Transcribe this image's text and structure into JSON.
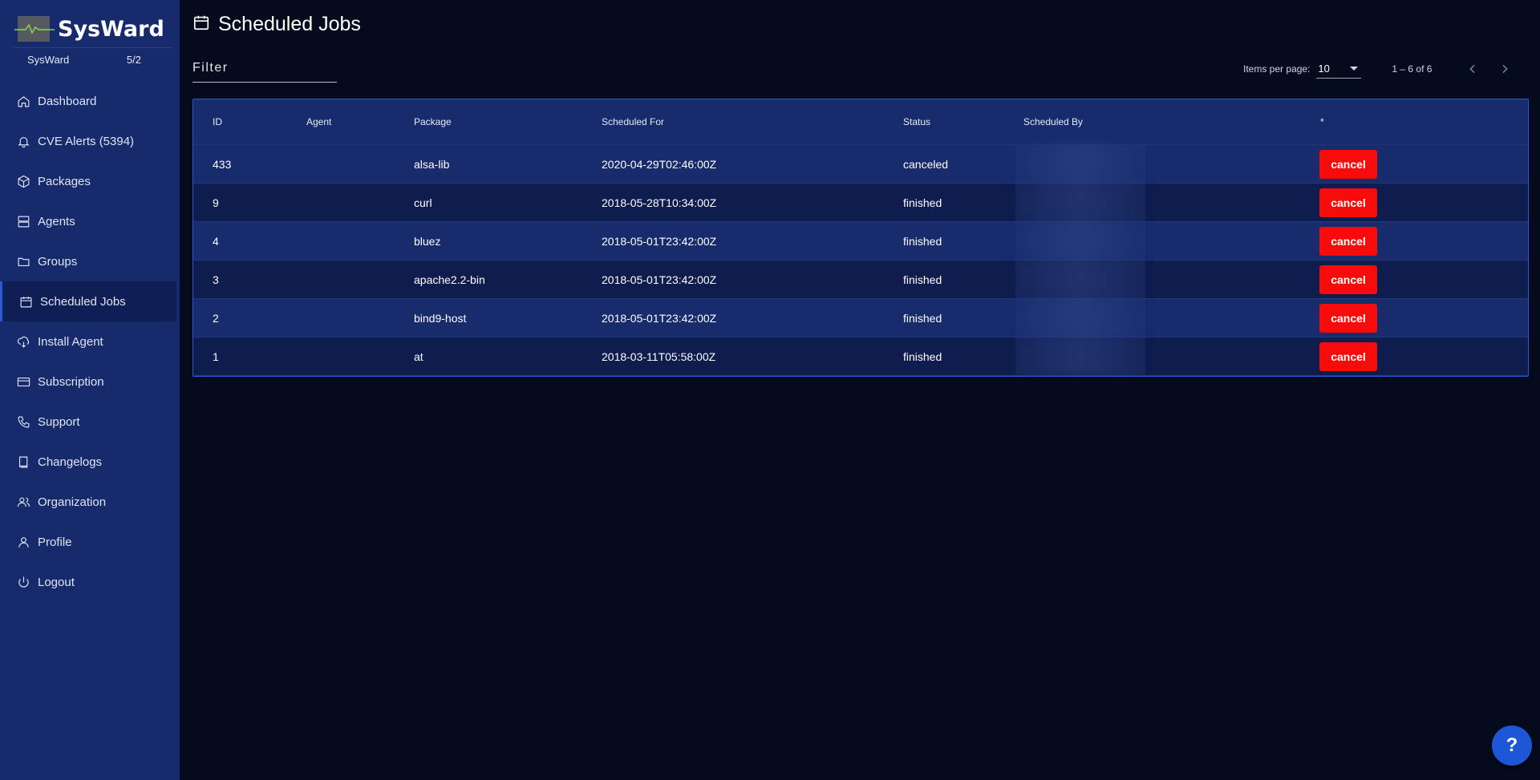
{
  "brand": {
    "name": "SysWard",
    "org_name": "SysWard",
    "org_count": "5/2"
  },
  "sidebar": {
    "items": [
      {
        "label": "Dashboard",
        "icon": "home-icon"
      },
      {
        "label": "CVE Alerts (5394)",
        "icon": "bell-icon"
      },
      {
        "label": "Packages",
        "icon": "box-icon"
      },
      {
        "label": "Agents",
        "icon": "server-icon"
      },
      {
        "label": "Groups",
        "icon": "folder-icon"
      },
      {
        "label": "Scheduled Jobs",
        "icon": "calendar-icon",
        "active": true
      },
      {
        "label": "Install Agent",
        "icon": "download-cloud-icon"
      },
      {
        "label": "Subscription",
        "icon": "credit-card-icon"
      },
      {
        "label": "Support",
        "icon": "phone-icon"
      },
      {
        "label": "Changelogs",
        "icon": "book-icon"
      },
      {
        "label": "Organization",
        "icon": "users-icon"
      },
      {
        "label": "Profile",
        "icon": "user-icon"
      },
      {
        "label": "Logout",
        "icon": "power-icon"
      }
    ]
  },
  "header": {
    "title": "Scheduled Jobs",
    "icon": "calendar-icon"
  },
  "filter": {
    "placeholder": "Filter",
    "value": ""
  },
  "paginator": {
    "items_per_page_label": "Items per page:",
    "items_per_page_value": "10",
    "range_label": "1 – 6 of 6"
  },
  "table": {
    "columns": [
      "ID",
      "Agent",
      "Package",
      "Scheduled For",
      "Status",
      "Scheduled By",
      "*"
    ],
    "rows": [
      {
        "id": "433",
        "agent": "",
        "package": "alsa-lib",
        "scheduled_for": "2020-04-29T02:46:00Z",
        "status": "canceled",
        "scheduled_by": "",
        "action": "cancel"
      },
      {
        "id": "9",
        "agent": "",
        "package": "curl",
        "scheduled_for": "2018-05-28T10:34:00Z",
        "status": "finished",
        "scheduled_by": "",
        "action": "cancel"
      },
      {
        "id": "4",
        "agent": "",
        "package": "bluez",
        "scheduled_for": "2018-05-01T23:42:00Z",
        "status": "finished",
        "scheduled_by": "",
        "action": "cancel"
      },
      {
        "id": "3",
        "agent": "",
        "package": "apache2.2-bin",
        "scheduled_for": "2018-05-01T23:42:00Z",
        "status": "finished",
        "scheduled_by": "",
        "action": "cancel"
      },
      {
        "id": "2",
        "agent": "",
        "package": "bind9-host",
        "scheduled_for": "2018-05-01T23:42:00Z",
        "status": "finished",
        "scheduled_by": "",
        "action": "cancel"
      },
      {
        "id": "1",
        "agent": "",
        "package": "at",
        "scheduled_for": "2018-03-11T05:58:00Z",
        "status": "finished",
        "scheduled_by": "",
        "action": "cancel"
      }
    ]
  },
  "help": {
    "label": "?"
  },
  "colors": {
    "sidebar_bg": "#172a6c",
    "page_bg": "#030b1d",
    "accent": "#2d58d6",
    "cancel_button": "#f70b0b",
    "help_button": "#1d57d8"
  }
}
